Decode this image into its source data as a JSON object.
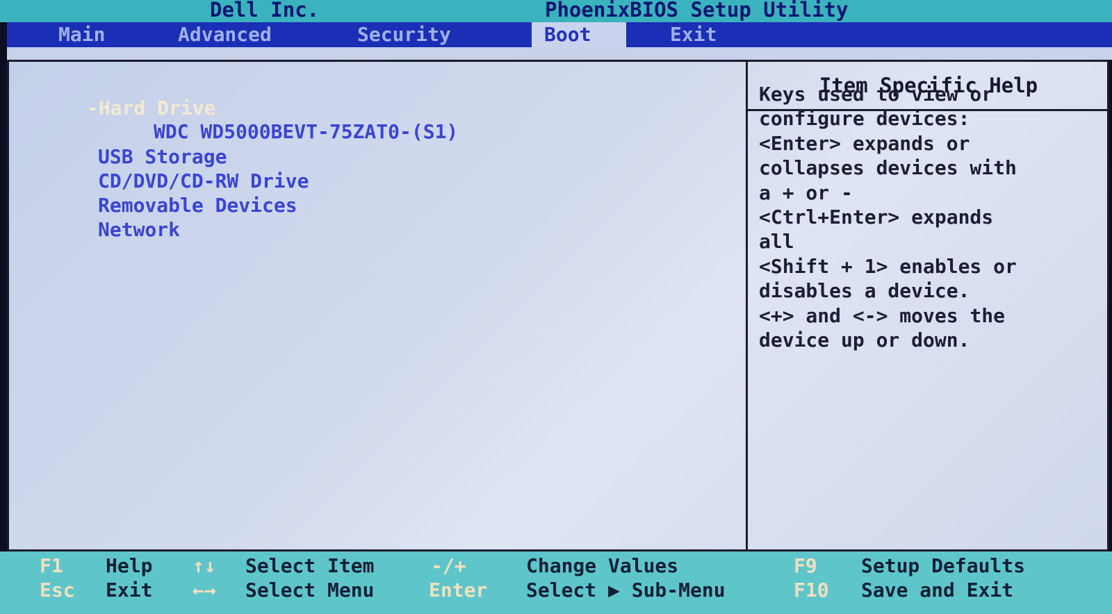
{
  "header": {
    "vendor": "Dell Inc.",
    "utility": "PhoenixBIOS Setup Utility"
  },
  "menu": {
    "tabs": [
      "Main",
      "Advanced",
      "Security",
      "Boot",
      "Exit"
    ],
    "active": "Boot"
  },
  "boot_list": {
    "group_label": "-Hard Drive",
    "device": "WDC WD5000BEVT-75ZAT0-(S1)",
    "items": [
      "USB Storage",
      "CD/DVD/CD-RW Drive",
      "Removable Devices",
      "Network"
    ]
  },
  "help": {
    "title": "Item Specific Help",
    "lines": [
      "Keys used to view or",
      "configure devices:",
      "<Enter> expands or",
      "collapses devices with",
      "a + or -",
      "<Ctrl+Enter> expands",
      "all",
      "<Shift + 1> enables or",
      "disables a device.",
      "<+> and <-> moves the",
      "device up or down."
    ]
  },
  "footer": {
    "row1": [
      {
        "key": "F1",
        "desc": "Help"
      },
      {
        "key": "↑↓",
        "desc": "Select Item"
      },
      {
        "key": "-/+",
        "desc": "Change Values"
      },
      {
        "key": "F9",
        "desc": "Setup Defaults"
      }
    ],
    "row2": [
      {
        "key": "Esc",
        "desc": "Exit"
      },
      {
        "key": "←→",
        "desc": "Select Menu"
      },
      {
        "key": "Enter",
        "desc": "Select ▶ Sub-Menu"
      },
      {
        "key": "F10",
        "desc": "Save and Exit"
      }
    ]
  },
  "colors": {
    "title_bg": "#3bb3bf",
    "menu_bg": "#1a2fb5",
    "active_tab_bg": "#c9d3ee",
    "body_bg": "#d3dbee",
    "item_text": "#3a45d0",
    "selected_text": "#f4ead2",
    "footer_bg": "#5ec6ca"
  }
}
